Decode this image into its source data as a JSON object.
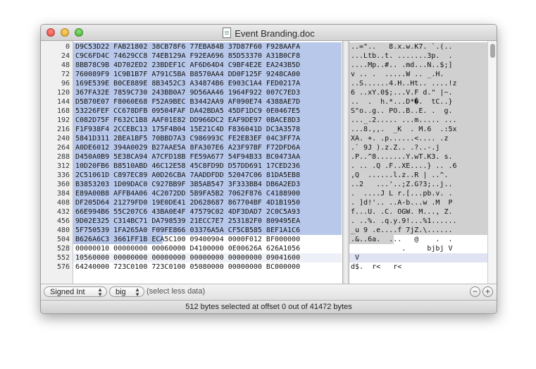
{
  "window": {
    "title": "Event Branding.doc"
  },
  "offsets": [
    "0",
    "24",
    "48",
    "72",
    "96",
    "120",
    "144",
    "168",
    "192",
    "216",
    "240",
    "264",
    "288",
    "312",
    "336",
    "360",
    "384",
    "408",
    "432",
    "456",
    "480",
    "504",
    "528",
    "552",
    "576"
  ],
  "hex_rows": [
    "D9C53D22 FAB21802 38CB78F6 77EBA84B 37D87F60 F928AAFA",
    "C9C6FD4C 74629CC8 74EB129A F92EA696 85D53370 A31B0CF8",
    "8BB78C9B 4D702ED2 23BDEF1C AF6D64D4 C9BF4E2E EA243B5D",
    "760089F9 1C9B1B7F A791C5BA B8570AA4 DD0F125F 9248CA00",
    "169E539E B0CE889E 8B3452C3 A34874B6 E903C1A4 FED0217A",
    "367FA32E 7859C730 243BB0A7 9D56AA46 1964F922 007C7ED3",
    "D5B70E07 F8060E68 F52A9BEC B3442AA9 AF090E74 4388AE7D",
    "53226FEF CC678DFB 09504FAF DA42BDA5 45DF1DC9 0E0467E5",
    "C082D75F F632C1B8 AAF01E82 DD966DC2 EAF9DE97 0BACE8D3",
    "F1F938F4 2CCEBC13 175F4B04 15E21C4D F836041D DC3A3578",
    "5841D311 2BEA1BF5 70BBD7A3 C986993C FE2EB3EF 04C3FF7A",
    "A0DE6012 394A0029 B27AAE5A 8FA307E6 A23F97BF F72DFD6A",
    "D450A0B9 5E38CA94 A7CFD18B FE59A677 54F94B33 BC0473AA",
    "10D20FB6 B8510ABD 46C12E58 45C8FD9D D57DD691 17CED236",
    "2C51061D C897EC89 A0D26CBA 7AADDFDD 52047C06 81DA5EB8",
    "B3853203 1D09DAC0 C927BB9F 3B5AB547 3F333BB4 DB6A2ED3",
    "E89A00B8 AFFB4A06 4C2072DD 5B9FA5B2 7062F876 C4188900",
    "DF205D64 21279FD0 19E0DE41 2D628687 867704BF 4D1B1950",
    "66E994B6 55C207C6 43BA0E4F 47579C02 4DF3DAD7 2C0C5A93",
    "9D02E325 C314BC71 DA798539 21ECC7E7 253182F0 809495EA",
    "5F750539 1FA265A0 F09FE866 03376A5A CF5CB585 8EF1A1C6",
    "B626A6C3 3661FF1B ECA5C100 09400904 0000F012 BF000000",
    "00000010 00000000 00060000 D4100000 0E00626A 626A1056",
    "10560000 00000000 00000000 00000000 00000000 09041600",
    "64240000 723C0100 723C0100 05080000 00000000 BC000000"
  ],
  "ascii_rows": [
    "..=\"..   8.x.w.K7. `.(..",
    "...Ltb..t. .......3p.  .",
    "....Mp..#.. .md...N..$;]",
    "v .. .  .....W .. _.H.",
    "..S......4.H..Ht.. ....!z",
    "6 ..xY.0$;...V.F d.\" |~.",
    "..  .  h.*...D*�.  tC..}",
    "S\"o..g.. PO..B..E. .  g.",
    "..._.2..... ...m..... ...",
    "...8.,,.  _K  . M.6  .:5x",
    "XA. +. .p......<.... .z",
    ".` 9J ).z.Z.. .?..-.j",
    ".P..^8.......Y.wT.K3. s.",
    ". .. .Q .F..XE....} .. .6",
    ",Q  ......l.z..R | ..^.",
    "..2   ...'..;Z.G?3;..j..",
    ".  ....J L r.[...pb.v. .",
    ". ]d!'.. ..A-b...w .M  P",
    "f...U. .C. OGW. M..., Z.",
    ". ..%. .q.y.9!...%1......",
    "_u 9 .e....f 7jZ.\\......",
    ".&..6a.  ...   @    .  .",
    "            .     bjbj V",
    " V",
    "d$.  r<   r<"
  ],
  "controls": {
    "type_popup": "Signed Int",
    "endian_popup": "big",
    "hint": "(select less data)"
  },
  "status": "512 bytes selected at offset 0 out of 41472 bytes"
}
